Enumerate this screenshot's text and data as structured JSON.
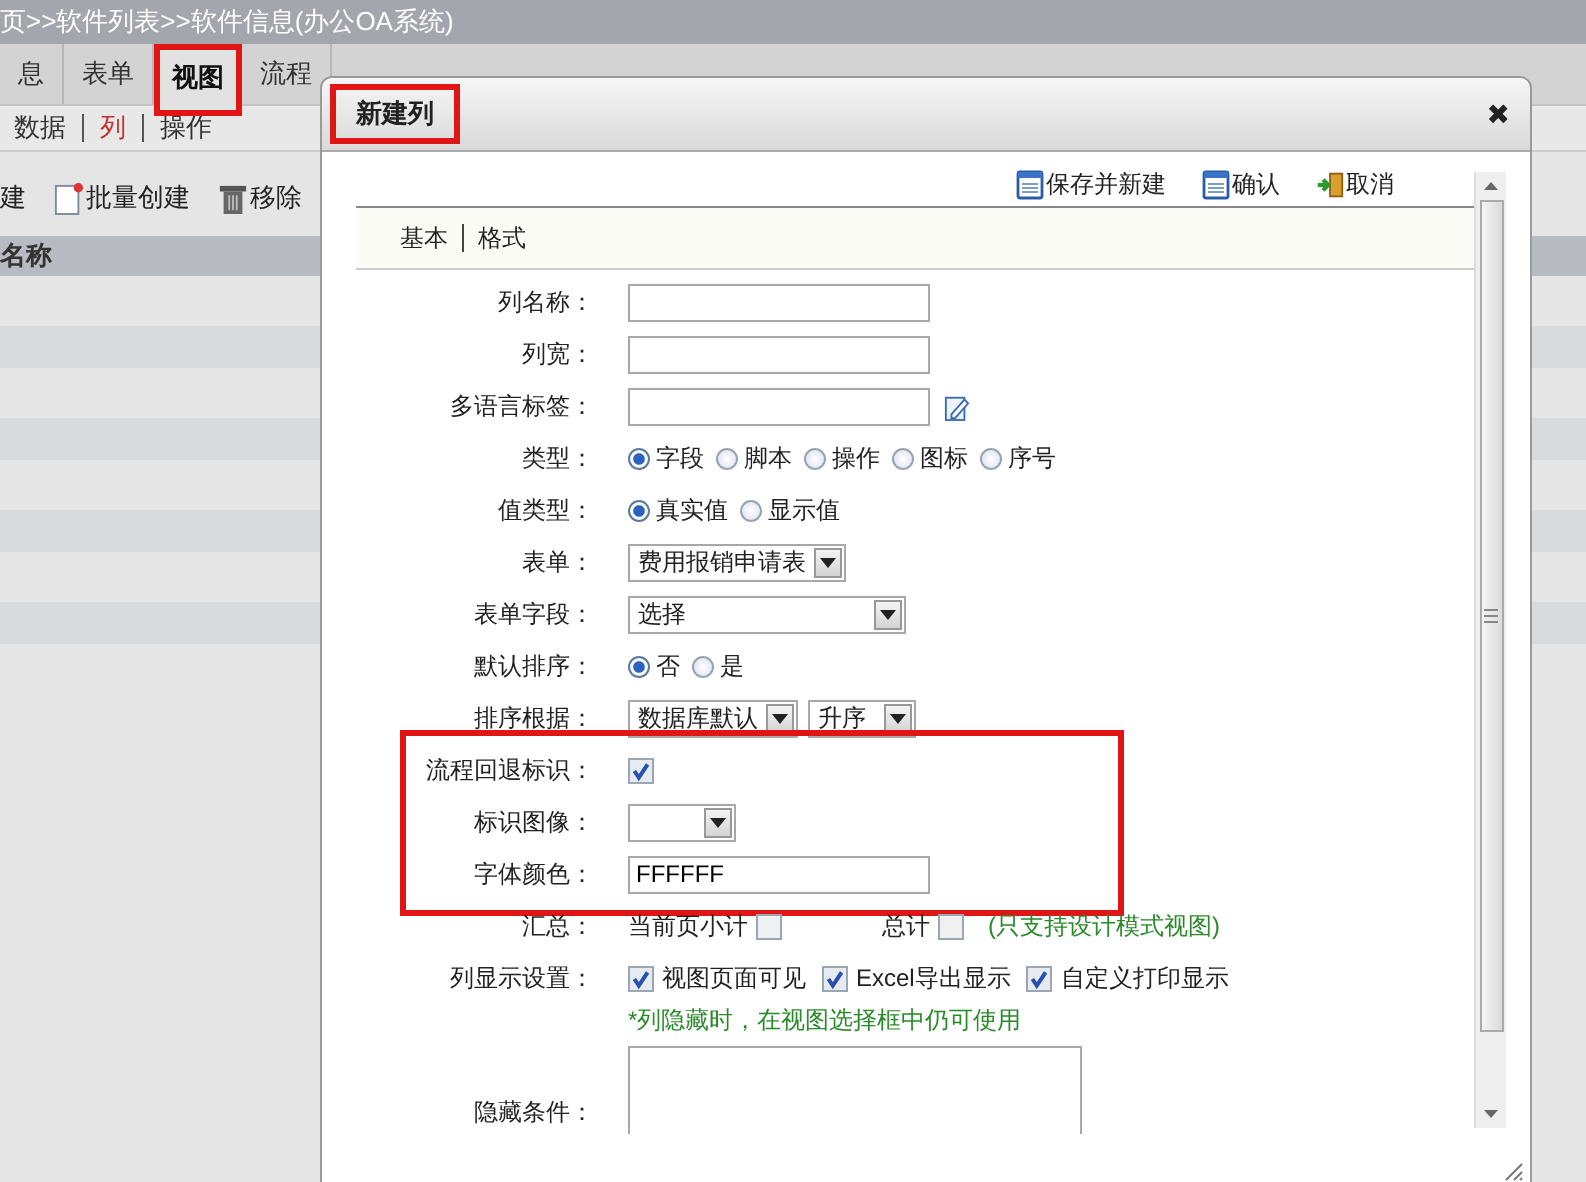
{
  "breadcrumb": "页>>软件列表>>软件信息(办公OA系统)",
  "tabs": [
    {
      "label": "息",
      "selected": false,
      "highlighted": false
    },
    {
      "label": "表单",
      "selected": false,
      "highlighted": false
    },
    {
      "label": "视图",
      "selected": true,
      "highlighted": true
    },
    {
      "label": "流程",
      "selected": false,
      "highlighted": false
    }
  ],
  "subtabs": [
    {
      "label": "数据",
      "selected": false
    },
    {
      "label": "列",
      "selected": true
    },
    {
      "label": "操作",
      "selected": false
    }
  ],
  "toolbar": [
    {
      "label": "建",
      "kind": "text"
    },
    {
      "label": "批量创建",
      "kind": "new"
    },
    {
      "label": "移除",
      "kind": "delete"
    }
  ],
  "table": {
    "columns": [
      "名称"
    ]
  },
  "dialog": {
    "title": "新建列",
    "title_highlighted": true,
    "close": "✖",
    "actions": [
      {
        "label": "保存并新建",
        "kind": "save"
      },
      {
        "label": "确认",
        "kind": "save"
      },
      {
        "label": "取消",
        "kind": "exit"
      }
    ],
    "tabs": [
      {
        "label": "基本"
      },
      {
        "label": "格式"
      }
    ],
    "form_rows": [
      {
        "kind": "text",
        "label": "列名称："
      },
      {
        "kind": "text",
        "label": "列宽："
      },
      {
        "kind": "text_edit",
        "label": "多语言标签："
      },
      {
        "kind": "radio",
        "label": "类型：",
        "options": [
          {
            "label": "字段",
            "selected": true
          },
          {
            "label": "脚本",
            "selected": false
          },
          {
            "label": "操作",
            "selected": false
          },
          {
            "label": "图标",
            "selected": false
          },
          {
            "label": "序号",
            "selected": false
          }
        ]
      },
      {
        "kind": "radio",
        "label": "值类型：",
        "options": [
          {
            "label": "真实值",
            "selected": true
          },
          {
            "label": "显示值",
            "selected": false
          }
        ]
      },
      {
        "kind": "select",
        "label": "表单：",
        "selects": [
          {
            "value": "费用报销申请表",
            "wide": false
          }
        ]
      },
      {
        "kind": "select",
        "label": "表单字段：",
        "selects": [
          {
            "value": "选择",
            "wide": true
          }
        ]
      },
      {
        "kind": "radio",
        "label": "默认排序：",
        "options": [
          {
            "label": "否",
            "selected": true
          },
          {
            "label": "是",
            "selected": false
          }
        ]
      },
      {
        "kind": "select",
        "label": "排序根据：",
        "selects": [
          {
            "value": "数据库默认",
            "wide": false
          },
          {
            "value": "升序",
            "wide": false
          }
        ]
      }
    ],
    "marked_rows": [
      {
        "kind": "checks",
        "label": "流程回退标识：",
        "items": [
          {
            "checked": true
          }
        ]
      },
      {
        "kind": "select",
        "label": "标识图像：",
        "selects": [
          {
            "wide": false
          }
        ]
      },
      {
        "kind": "text",
        "label": "字体颜色：",
        "value": "FFFFFF"
      }
    ],
    "more_rows": [
      {
        "kind": "checks_label_first",
        "label": "汇总：",
        "items": [
          {
            "label": "当前页小计",
            "checked": false
          },
          {
            "label": "总计",
            "checked": false
          }
        ],
        "note": "(只支持设计模式视图)"
      },
      {
        "kind": "checks",
        "label": "列显示设置：",
        "items": [
          {
            "label": "视图页面可见",
            "checked": true
          },
          {
            "label": "Excel导出显示",
            "checked": true
          },
          {
            "label": "自定义打印显示",
            "checked": true
          }
        ]
      },
      {
        "kind": "note",
        "text": "*列隐藏时，在视图选择框中仍可使用"
      },
      {
        "kind": "textarea",
        "label": "隐藏条件："
      }
    ]
  }
}
